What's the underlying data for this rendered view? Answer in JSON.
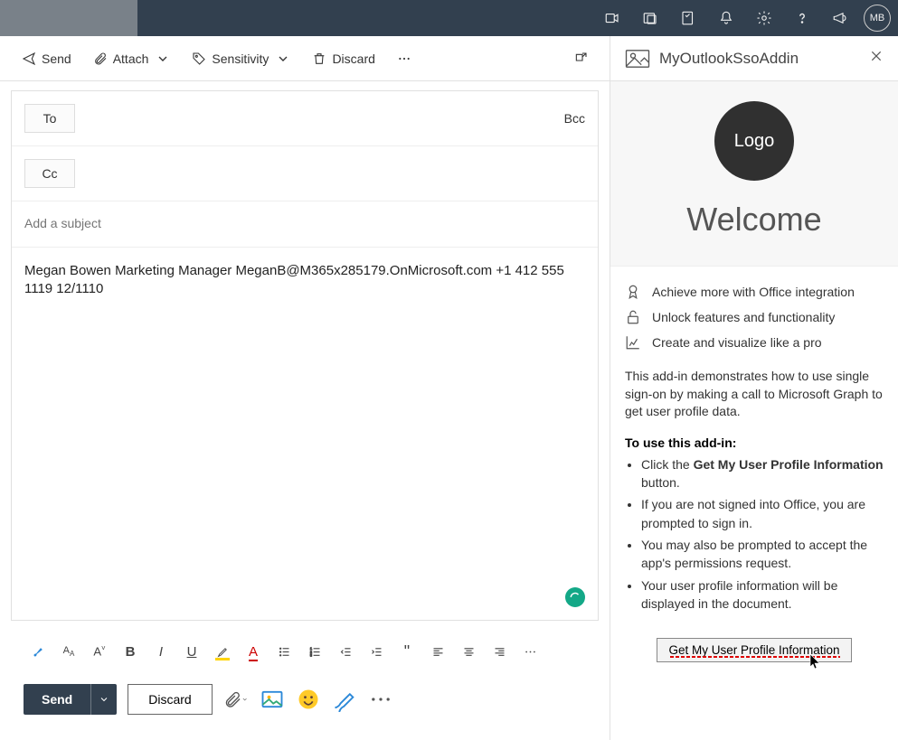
{
  "titlebar": {
    "avatar_initials": "MB"
  },
  "cmdbar": {
    "send": "Send",
    "attach": "Attach",
    "sensitivity": "Sensitivity",
    "discard": "Discard"
  },
  "recipients": {
    "to_label": "To",
    "cc_label": "Cc",
    "bcc_label": "Bcc",
    "subject_placeholder": "Add a subject"
  },
  "body": {
    "text": "Megan Bowen Marketing Manager MeganB@M365x285179.OnMicrosoft.com +1 412 555 1119 12/1110"
  },
  "bottom": {
    "send": "Send",
    "discard": "Discard"
  },
  "addin": {
    "title": "MyOutlookSsoAddin",
    "logo_text": "Logo",
    "welcome": "Welcome",
    "features": {
      "f1": "Achieve more with Office integration",
      "f2": "Unlock features and functionality",
      "f3": "Create and visualize like a pro"
    },
    "description": "This add-in demonstrates how to use single sign-on by making a call to Microsoft Graph to get user profile data.",
    "instructions_heading": "To use this add-in:",
    "list": {
      "i1a": "Click the ",
      "i1b": "Get My User Profile Information",
      "i1c": " button.",
      "i2": "If you are not signed into Office, you are prompted to sign in.",
      "i3": "You may also be prompted to accept the app's permissions request.",
      "i4": "Your user profile information will be displayed in the document."
    },
    "cta": "Get My User Profile Information"
  }
}
